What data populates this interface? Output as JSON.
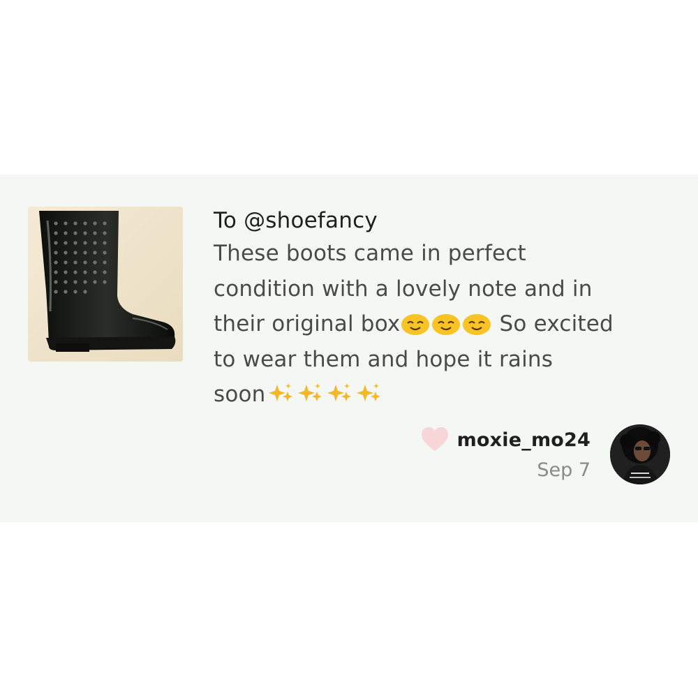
{
  "review": {
    "recipient": "To @shoefancy",
    "lines": [
      "These boots came in perfect",
      "condition with a lovely note and in",
      "their original box",
      " So excited",
      "to wear them and hope it rains",
      "soon"
    ],
    "emojis": {
      "after_box": [
        "smiling-face-icon",
        "smiling-face-icon",
        "smiling-face-icon"
      ],
      "after_soon": [
        "sparkles-icon",
        "sparkles-icon",
        "sparkles-icon",
        "sparkles-icon"
      ]
    }
  },
  "author": {
    "username": "moxie_mo24",
    "date": "Sep 7"
  },
  "colors": {
    "card_background": "#f4f7f3",
    "heart": "#f6d6d6",
    "emoji_yellow": "#f7c325",
    "sparkle_yellow": "#f3b72a"
  },
  "icons": {
    "product": "rain-boot-image",
    "like": "heart-icon",
    "avatar": "user-avatar"
  }
}
